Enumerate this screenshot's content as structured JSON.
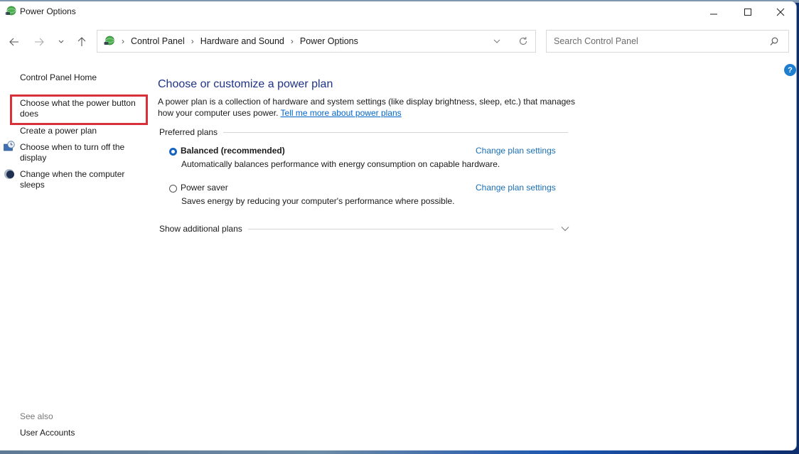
{
  "window": {
    "title": "Power Options",
    "minimize_label": "Minimize",
    "maximize_label": "Maximize",
    "close_label": "Close"
  },
  "nav": {
    "back_icon": "arrow-left-icon",
    "forward_icon": "arrow-right-icon",
    "recent_icon": "chevron-down-icon",
    "up_icon": "arrow-up-icon",
    "breadcrumb": [
      "Control Panel",
      "Hardware and Sound",
      "Power Options"
    ],
    "search_placeholder": "Search Control Panel"
  },
  "sidebar": {
    "items": [
      {
        "label": "Control Panel Home"
      },
      {
        "label": "Choose what the power button does",
        "highlighted": true
      },
      {
        "label": "Create a power plan"
      },
      {
        "label": "Choose when to turn off the display",
        "icon": "display-clock-icon"
      },
      {
        "label": "Change when the computer sleeps",
        "icon": "moon-icon"
      }
    ],
    "see_also_label": "See also",
    "see_also_items": [
      {
        "label": "User Accounts"
      }
    ]
  },
  "main": {
    "title": "Choose or customize a power plan",
    "description": "A power plan is a collection of hardware and system settings (like display brightness, sleep, etc.) that manages how your computer uses power.",
    "learn_more_link": "Tell me more about power plans",
    "preferred_plans_label": "Preferred plans",
    "plans": [
      {
        "name": "Balanced (recommended)",
        "selected": true,
        "description": "Automatically balances performance with energy consumption on capable hardware.",
        "change_label": "Change plan settings"
      },
      {
        "name": "Power saver",
        "selected": false,
        "description": "Saves energy by reducing your computer's performance where possible.",
        "change_label": "Change plan settings"
      }
    ],
    "additional_plans_label": "Show additional plans",
    "help_label": "?"
  },
  "colors": {
    "heading": "#1e3287",
    "link": "#1a6fb5",
    "highlight_box": "#d8313b",
    "radio_selected": "#1565c0"
  }
}
